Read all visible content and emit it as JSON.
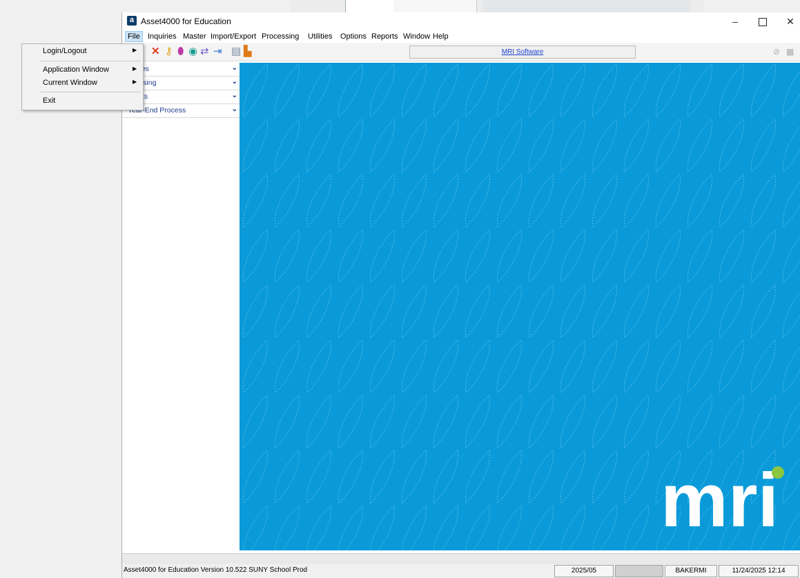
{
  "window": {
    "title": "Asset4000 for Education",
    "logo_letter": "a"
  },
  "window_controls": {
    "minimize": "–",
    "close": "✕"
  },
  "menu_bar": [
    "File",
    "Inquiries",
    "Master",
    "Import/Export",
    "Processing",
    "Utilities",
    "Options",
    "Reports",
    "Window",
    "Help"
  ],
  "toolbar": {
    "link": "MRI Software"
  },
  "nav_panel": [
    "quiries",
    "ocessing",
    "eports",
    "Year-End Process"
  ],
  "file_menu": {
    "items": [
      {
        "label": "Login/Logout",
        "submenu": true
      },
      {
        "label": "Application Window",
        "submenu": true
      },
      {
        "label": "Current Window",
        "submenu": true
      },
      {
        "label": "Exit",
        "submenu": false
      }
    ]
  },
  "brand": {
    "logo_text": "mri",
    "accent": "#8dc63f",
    "background": "#0a9ad9"
  },
  "status_bar": {
    "version": "Asset4000 for Education Version 10.522 SUNY School Prod",
    "period": "2025/05",
    "user": "BAKERMI",
    "datetime": "11/24/2025 12:14"
  }
}
